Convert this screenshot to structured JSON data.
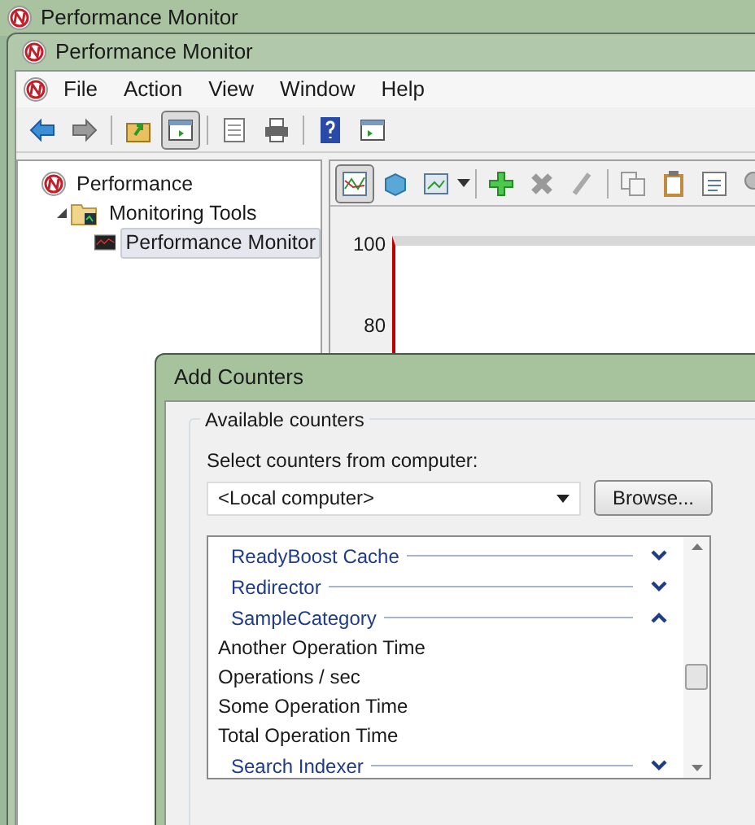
{
  "back_window": {
    "title": "Performance Monitor"
  },
  "main_window": {
    "title": "Performance Monitor"
  },
  "menu": [
    "File",
    "Action",
    "View",
    "Window",
    "Help"
  ],
  "toolbar": [
    {
      "kind": "back",
      "pressed": false
    },
    {
      "kind": "forward",
      "pressed": false
    },
    {
      "kind": "up",
      "pressed": false
    },
    {
      "kind": "tree",
      "pressed": true
    },
    {
      "kind": "list",
      "pressed": false
    },
    {
      "kind": "print",
      "pressed": false
    },
    {
      "kind": "help",
      "pressed": false
    },
    {
      "kind": "pane",
      "pressed": false
    }
  ],
  "tree": [
    {
      "label": "Performance",
      "selected": false,
      "children": [
        {
          "label": "Monitoring Tools",
          "selected": false,
          "expanded": true,
          "children": [
            {
              "label": "Performance Monitor",
              "selected": true
            }
          ]
        }
      ]
    }
  ],
  "chart_toolbar": [
    {
      "kind": "graph",
      "pressed": true
    },
    {
      "kind": "cube",
      "pressed": false
    },
    {
      "kind": "view",
      "pressed": false
    },
    {
      "kind": "add",
      "pressed": false
    },
    {
      "kind": "delete",
      "pressed": false
    },
    {
      "kind": "edit",
      "pressed": false
    },
    {
      "kind": "copy",
      "pressed": false
    },
    {
      "kind": "paste",
      "pressed": false
    },
    {
      "kind": "properties",
      "pressed": false
    },
    {
      "kind": "zoom",
      "pressed": false
    }
  ],
  "chart_axis_labels": [
    "100",
    "80"
  ],
  "dialog": {
    "title": "Add Counters",
    "group_label": "Available counters",
    "computer_label": "Select counters from computer:",
    "computer_value": "<Local computer>",
    "browse_button": "Browse...",
    "counters": [
      {
        "kind": "category",
        "label": "ReadyBoost Cache",
        "expanded": false
      },
      {
        "kind": "category",
        "label": "Redirector",
        "expanded": false
      },
      {
        "kind": "category",
        "label": "SampleCategory",
        "expanded": true
      },
      {
        "kind": "counter",
        "label": "Another Operation Time"
      },
      {
        "kind": "counter",
        "label": "Operations / sec"
      },
      {
        "kind": "counter",
        "label": "Some Operation Time"
      },
      {
        "kind": "counter",
        "label": "Total Operation Time"
      },
      {
        "kind": "category",
        "label": "Search Indexer",
        "expanded": false
      }
    ]
  }
}
